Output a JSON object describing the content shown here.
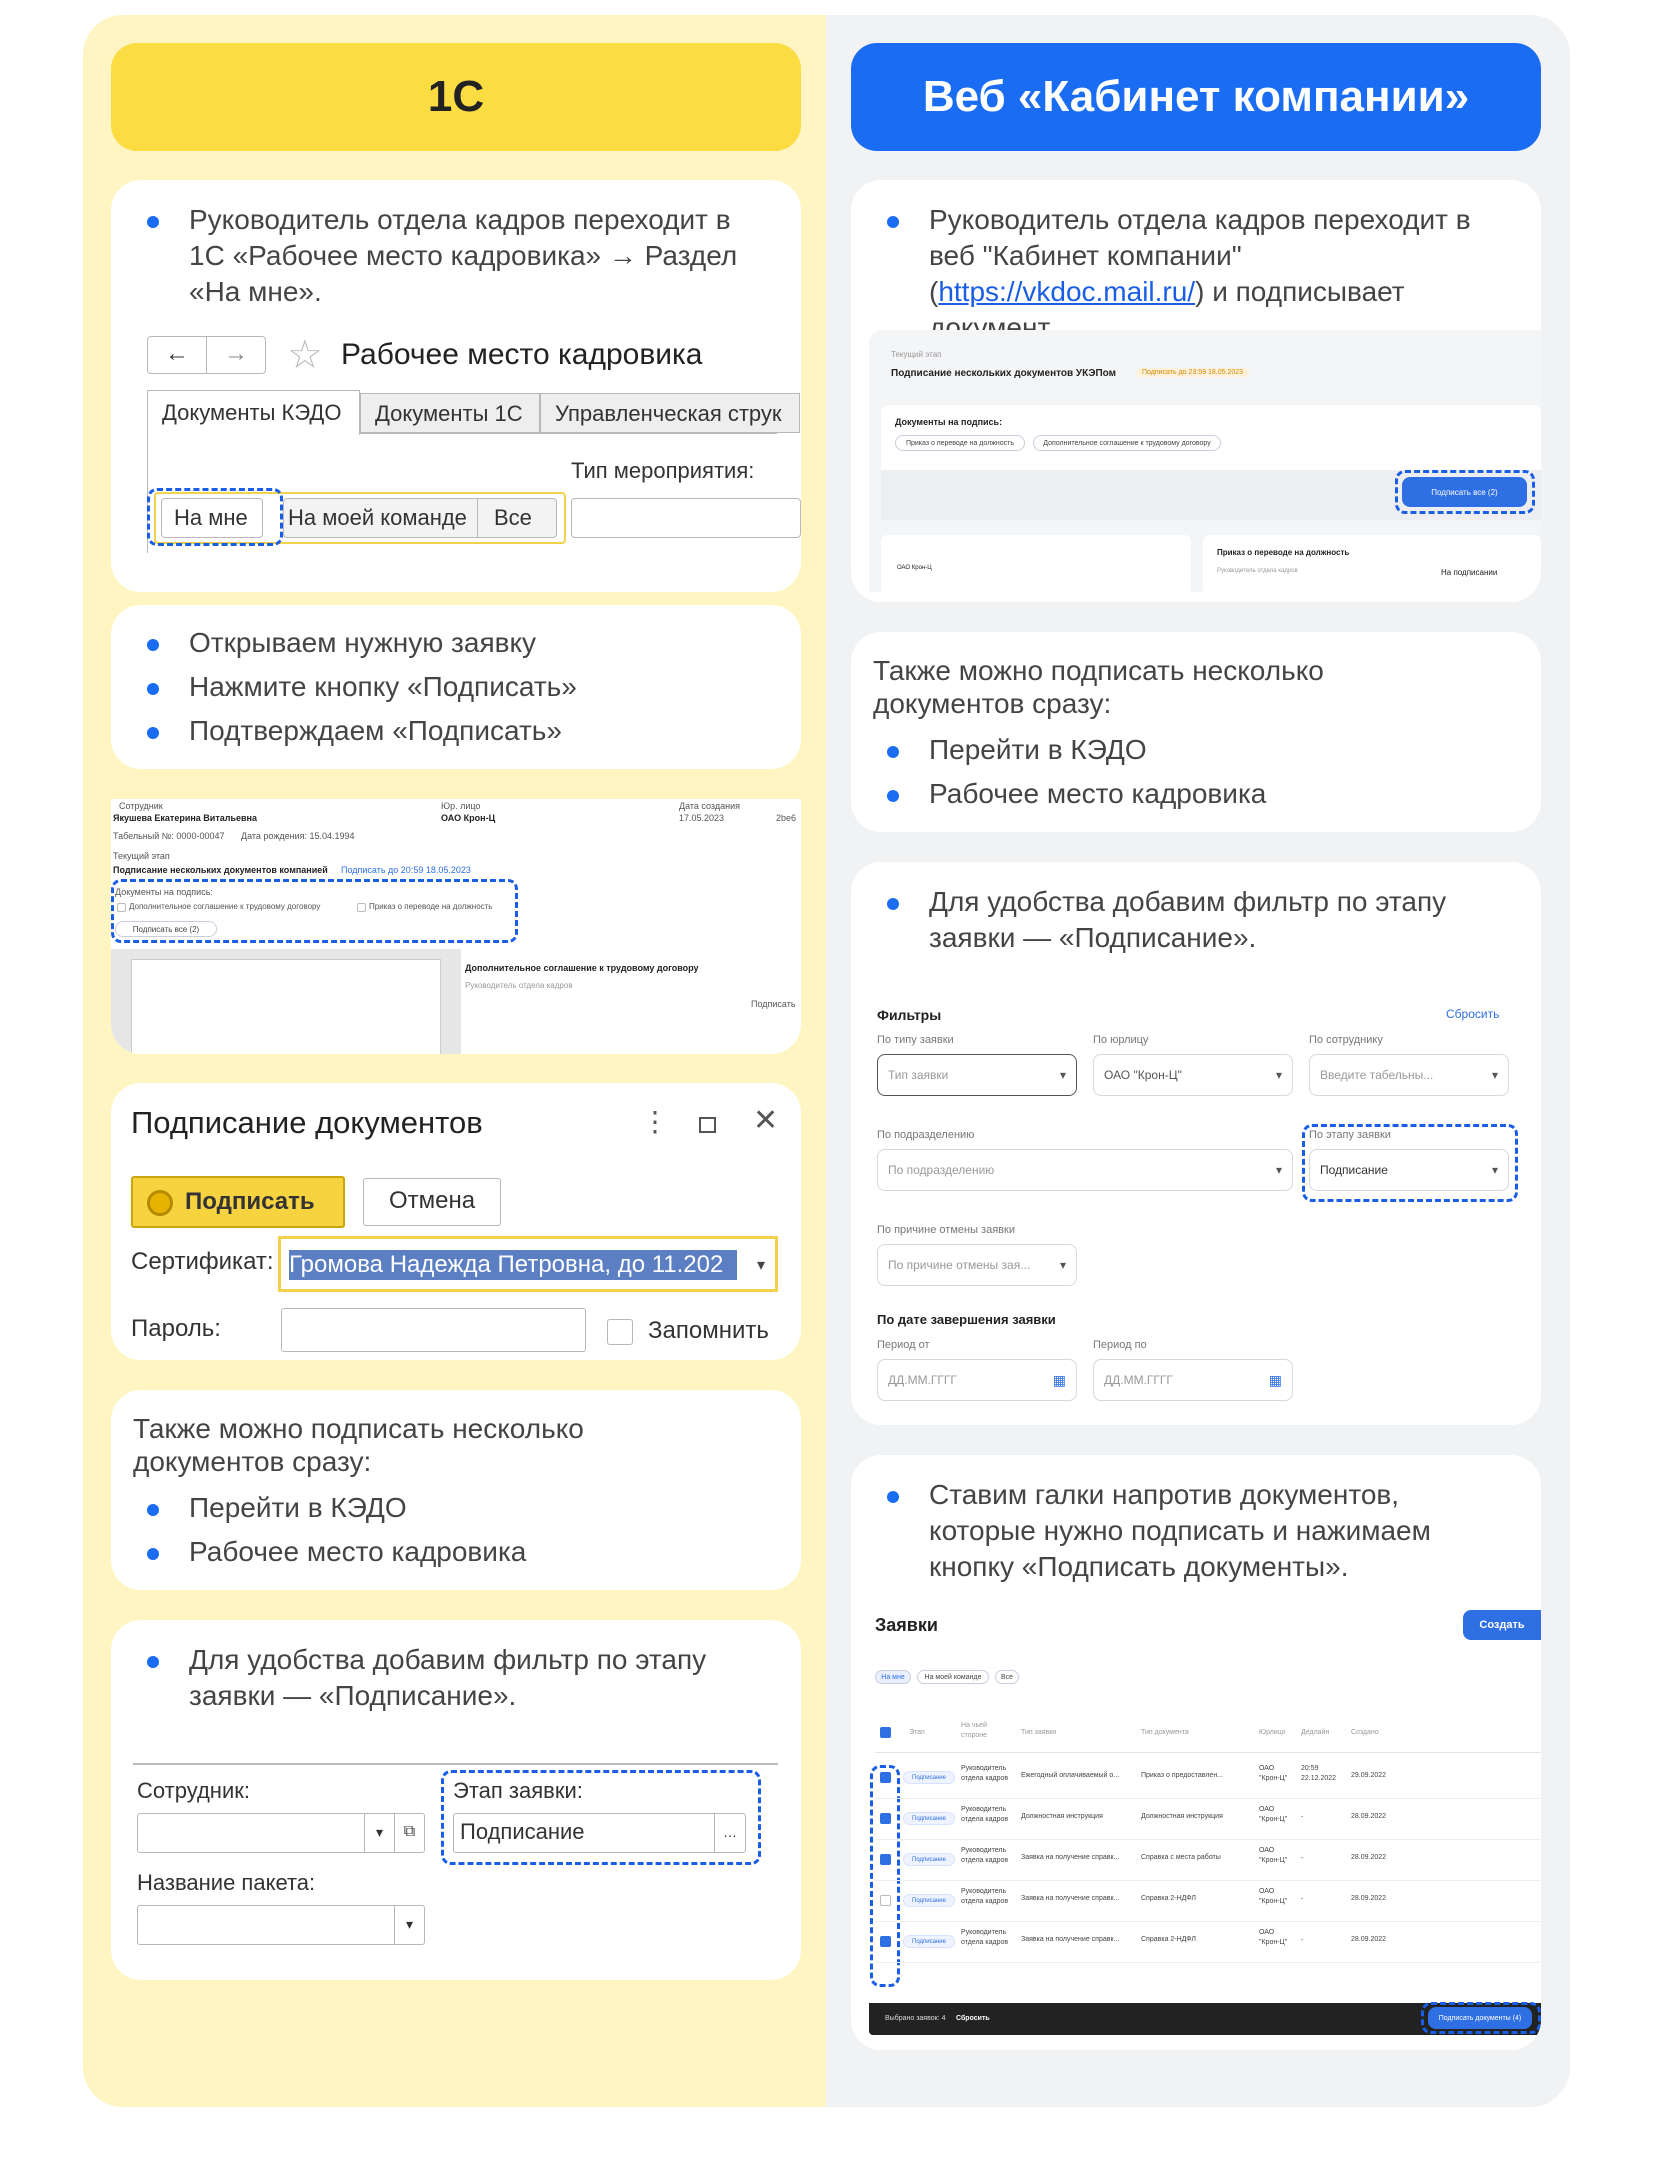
{
  "headers": {
    "left": "1С",
    "right": "Веб «Кабинет компании»"
  },
  "left": {
    "c1": {
      "bullet": "Руководитель отдела кадров переходит в 1С «Рабочее место кадровика» → Раздел «На мне».",
      "window_title": "Рабочее место кадровика",
      "tabs": [
        "Документы КЭДО",
        "Документы 1С",
        "Управленческая струк"
      ],
      "event_type_label": "Тип мероприятия:",
      "filter_buttons": [
        "На мне",
        "На моей команде",
        "Все"
      ]
    },
    "c2": {
      "bullets": [
        "Открываем нужную заявку",
        "Нажмите кнопку «Подписать»",
        "Подтверждаем «Подписать»"
      ]
    },
    "shot": {
      "employee_label": "Сотрудник",
      "employee": "Якушева Екатерина Витальевна",
      "tab_no": "Табельный №: 0000-00047",
      "birth": "Дата рождения: 15.04.1994",
      "legal_label": "Юр. лицо",
      "legal": "ОАО Крон-Ц",
      "created_label": "Дата создания",
      "created": "17.05.2023",
      "id": "2be6",
      "stage_label": "Текущий этап",
      "stage": "Подписание нескольких документов компанией",
      "deadline": "Подписать до 20:59 18.05.2023",
      "docs_label": "Документы на подпись:",
      "doc1": "Дополнительное соглашение к трудовому договору",
      "doc2": "Приказ о переводе на должность",
      "sign_all": "Подписать все (2)",
      "doc_title": "Дополнительное соглашение к трудовому договору",
      "doc_role": "Руководитель отдела кадров",
      "doc_status": "Подписать"
    },
    "dialog": {
      "title": "Подписание документов",
      "sign": "Подписать",
      "cancel": "Отмена",
      "cert_label": "Сертификат:",
      "cert": "Громова Надежда Петровна, до 11.202",
      "pass_label": "Пароль:",
      "remember": "Запомнить"
    },
    "c4": {
      "text": "Также можно подписать несколько документов сразу:",
      "bullets": [
        "Перейти в КЭДО",
        "Рабочее место кадровика"
      ]
    },
    "c5": {
      "bullet": "Для удобства добавим фильтр по этапу заявки — «Подписание».",
      "employee_label": "Сотрудник:",
      "stage_label": "Этап заявки:",
      "stage_value": "Подписание",
      "package_label": "Название пакета:"
    }
  },
  "right": {
    "c1": {
      "pre": "Руководитель отдела кадров переходит в веб \"Кабинет компании\" (",
      "link": "https://vkdoc.mail.ru/",
      "post": ") и подписывает документ.",
      "stage_label": "Текущий этап",
      "stage": "Подписание нескольких документов УКЭПом",
      "deadline": "Подписать до 23:59 18.05.2023",
      "docs_label": "Документы на подпись:",
      "doc1": "Приказ о переводе на должность",
      "doc2": "Дополнительное соглашение к трудовому договору",
      "sign_all": "Подписать все (2)",
      "card_title": "Приказ о переводе на должность",
      "card_role": "Руководитель отдела кадров",
      "card_status": "На подписании",
      "org": "ОАО Крон-Ц"
    },
    "c2": {
      "text": "Также можно подписать несколько документов сразу:",
      "bullets": [
        "Перейти в КЭДО",
        "Рабочее место кадровика"
      ]
    },
    "c3": {
      "bullet": "Для удобства добавим фильтр по этапу заявки — «Подписание».",
      "title": "Фильтры",
      "reset": "Сбросить",
      "f1_label": "По типу заявки",
      "f1": "Тип заявки",
      "f2_label": "По юрлицу",
      "f2": "ОАО \"Крон-Ц\"",
      "f3_label": "По сотруднику",
      "f3": "Введите табельны...",
      "f4_label": "По подразделению",
      "f4": "По подразделению",
      "f5_label": "По этапу заявки",
      "f5": "Подписание",
      "f6_label": "По причине отмены заявки",
      "f6": "По причине отмены зая...",
      "date_title": "По дате завершения заявки",
      "from_label": "Период от",
      "to_label": "Период по",
      "date_ph": "ДД.ММ.ГГГГ"
    },
    "c4": {
      "bullet": "Ставим галки напротив документов, которые нужно подписать и нажимаем кнопку «Подписать документы».",
      "title": "Заявки",
      "create": "Создать",
      "filters": [
        "На мне",
        "На моей команде",
        "Все"
      ],
      "columns": [
        "Этап",
        "На чьей стороне",
        "Тип заявки",
        "Тип документа",
        "Юрлицо",
        "Дедлайн",
        "Создано"
      ],
      "rows": [
        {
          "stage": "Подписание",
          "side": "Руководитель отдела кадров",
          "type": "Ежегодный оплачиваемый о...",
          "doc": "Приказ о предоставлен...",
          "org": "ОАО \"Крон-Ц\"",
          "deadline": "20:59 22.12.2022",
          "created": "29.09.2022",
          "checked": true
        },
        {
          "stage": "Подписание",
          "side": "Руководитель отдела кадров",
          "type": "Должностная инструкция",
          "doc": "Должностная инструкция",
          "org": "ОАО \"Крон-Ц\"",
          "deadline": "-",
          "created": "28.09.2022",
          "checked": true
        },
        {
          "stage": "Подписание",
          "side": "Руководитель отдела кадров",
          "type": "Заявка на получение справк...",
          "doc": "Справка с места работы",
          "org": "ОАО \"Крон-Ц\"",
          "deadline": "-",
          "created": "28.09.2022",
          "checked": true
        },
        {
          "stage": "Подписание",
          "side": "Руководитель отдела кадров",
          "type": "Заявка на получение справк...",
          "doc": "Справка 2-НДФЛ",
          "org": "ОАО \"Крон-Ц\"",
          "deadline": "-",
          "created": "28.09.2022",
          "checked": false
        },
        {
          "stage": "Подписание",
          "side": "Руководитель отдела кадров",
          "type": "Заявка на получение справк...",
          "doc": "Справка 2-НДФЛ",
          "org": "ОАО \"Крон-Ц\"",
          "deadline": "-",
          "created": "28.09.2022",
          "checked": true
        }
      ],
      "selected": "Выбрано заявок: 4",
      "reset": "Сбросить",
      "sign_docs": "Подписать документы (4)"
    }
  }
}
